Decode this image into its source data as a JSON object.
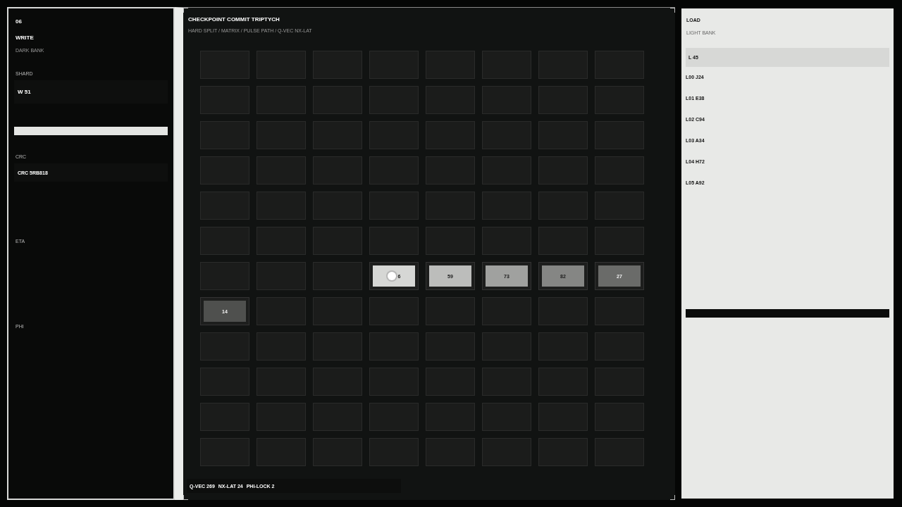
{
  "left_panel": {
    "index": "06",
    "title": "WRITE",
    "subtitle": "DARK BANK",
    "shard_label": "SHARD",
    "shard_value": "W 51",
    "meter": {
      "level": 1
    },
    "crc_label": "CRC",
    "crc_value": "CRC 5RB818",
    "eta_label": "ETA",
    "phi_label": "PHI"
  },
  "center_panel": {
    "title": "CHECKPOINT COMMIT TRIPTYCH",
    "breadcrumb": "HARD SPLIT / MATRIX / PULSE PATH / Q-VEC NX-LAT",
    "grid": {
      "rows": [
        {
          "cells": [
            {
              "kind": "empty"
            },
            {
              "kind": "empty"
            },
            {
              "kind": "empty"
            },
            {
              "kind": "empty"
            },
            {
              "kind": "empty"
            },
            {
              "kind": "empty"
            },
            {
              "kind": "empty"
            },
            {
              "kind": "empty"
            }
          ]
        },
        {
          "cells": [
            {
              "kind": "empty"
            },
            {
              "kind": "empty"
            },
            {
              "kind": "empty"
            },
            {
              "kind": "empty"
            },
            {
              "kind": "empty"
            },
            {
              "kind": "empty"
            },
            {
              "kind": "empty"
            },
            {
              "kind": "empty"
            }
          ]
        },
        {
          "cells": [
            {
              "kind": "empty"
            },
            {
              "kind": "empty"
            },
            {
              "kind": "empty"
            },
            {
              "kind": "empty"
            },
            {
              "kind": "empty"
            },
            {
              "kind": "empty"
            },
            {
              "kind": "empty"
            },
            {
              "kind": "empty"
            }
          ]
        },
        {
          "cells": [
            {
              "kind": "empty"
            },
            {
              "kind": "empty"
            },
            {
              "kind": "empty"
            },
            {
              "kind": "empty"
            },
            {
              "kind": "empty"
            },
            {
              "kind": "empty"
            },
            {
              "kind": "empty"
            },
            {
              "kind": "empty"
            }
          ]
        },
        {
          "cells": [
            {
              "kind": "empty"
            },
            {
              "kind": "empty"
            },
            {
              "kind": "empty"
            },
            {
              "kind": "empty"
            },
            {
              "kind": "empty"
            },
            {
              "kind": "empty"
            },
            {
              "kind": "empty"
            },
            {
              "kind": "empty"
            }
          ]
        },
        {
          "cells": [
            {
              "kind": "empty"
            },
            {
              "kind": "empty"
            },
            {
              "kind": "empty"
            },
            {
              "kind": "empty"
            },
            {
              "kind": "empty"
            },
            {
              "kind": "empty"
            },
            {
              "kind": "empty"
            },
            {
              "kind": "empty"
            }
          ]
        },
        {
          "cells": [
            {
              "kind": "empty"
            },
            {
              "kind": "empty"
            },
            {
              "kind": "empty"
            },
            {
              "kind": "block",
              "label": "6",
              "color": "#d6d7d5",
              "focused": true
            },
            {
              "kind": "block",
              "label": "59",
              "color": "#bcbdbb",
              "focused": false
            },
            {
              "kind": "block",
              "label": "73",
              "color": "#a0a19f",
              "focused": false
            },
            {
              "kind": "block",
              "label": "82",
              "color": "#858684",
              "focused": false
            },
            {
              "kind": "block",
              "label": "27",
              "color": "#6a6b69",
              "focused": false
            }
          ]
        },
        {
          "cells": [
            {
              "kind": "block",
              "label": "14",
              "color": "#4f504e",
              "focused": false
            },
            {
              "kind": "empty"
            },
            {
              "kind": "empty"
            },
            {
              "kind": "empty"
            },
            {
              "kind": "empty"
            },
            {
              "kind": "empty"
            },
            {
              "kind": "empty"
            },
            {
              "kind": "empty"
            }
          ]
        },
        {
          "cells": [
            {
              "kind": "empty"
            },
            {
              "kind": "empty"
            },
            {
              "kind": "empty"
            },
            {
              "kind": "empty"
            },
            {
              "kind": "empty"
            },
            {
              "kind": "empty"
            },
            {
              "kind": "empty"
            },
            {
              "kind": "empty"
            }
          ]
        },
        {
          "cells": [
            {
              "kind": "empty"
            },
            {
              "kind": "empty"
            },
            {
              "kind": "empty"
            },
            {
              "kind": "empty"
            },
            {
              "kind": "empty"
            },
            {
              "kind": "empty"
            },
            {
              "kind": "empty"
            },
            {
              "kind": "empty"
            }
          ]
        },
        {
          "cells": [
            {
              "kind": "empty"
            },
            {
              "kind": "empty"
            },
            {
              "kind": "empty"
            },
            {
              "kind": "empty"
            },
            {
              "kind": "empty"
            },
            {
              "kind": "empty"
            },
            {
              "kind": "empty"
            },
            {
              "kind": "empty"
            }
          ]
        },
        {
          "cells": [
            {
              "kind": "empty"
            },
            {
              "kind": "empty"
            },
            {
              "kind": "empty"
            },
            {
              "kind": "empty"
            },
            {
              "kind": "empty"
            },
            {
              "kind": "empty"
            },
            {
              "kind": "empty"
            },
            {
              "kind": "empty"
            }
          ]
        }
      ]
    },
    "status": [
      "Q-VEC 269",
      "NX-LAT 24",
      "PHI-LOCK 2"
    ]
  },
  "right_panel": {
    "title": "LOAD",
    "subtitle": "LIGHT BANK",
    "readout": "L 45",
    "entries": [
      "L00 J24",
      "L01 E38",
      "L02 C94",
      "L03 A34",
      "L04 H72",
      "L05 A92"
    ],
    "meter": {
      "level": 1
    }
  }
}
